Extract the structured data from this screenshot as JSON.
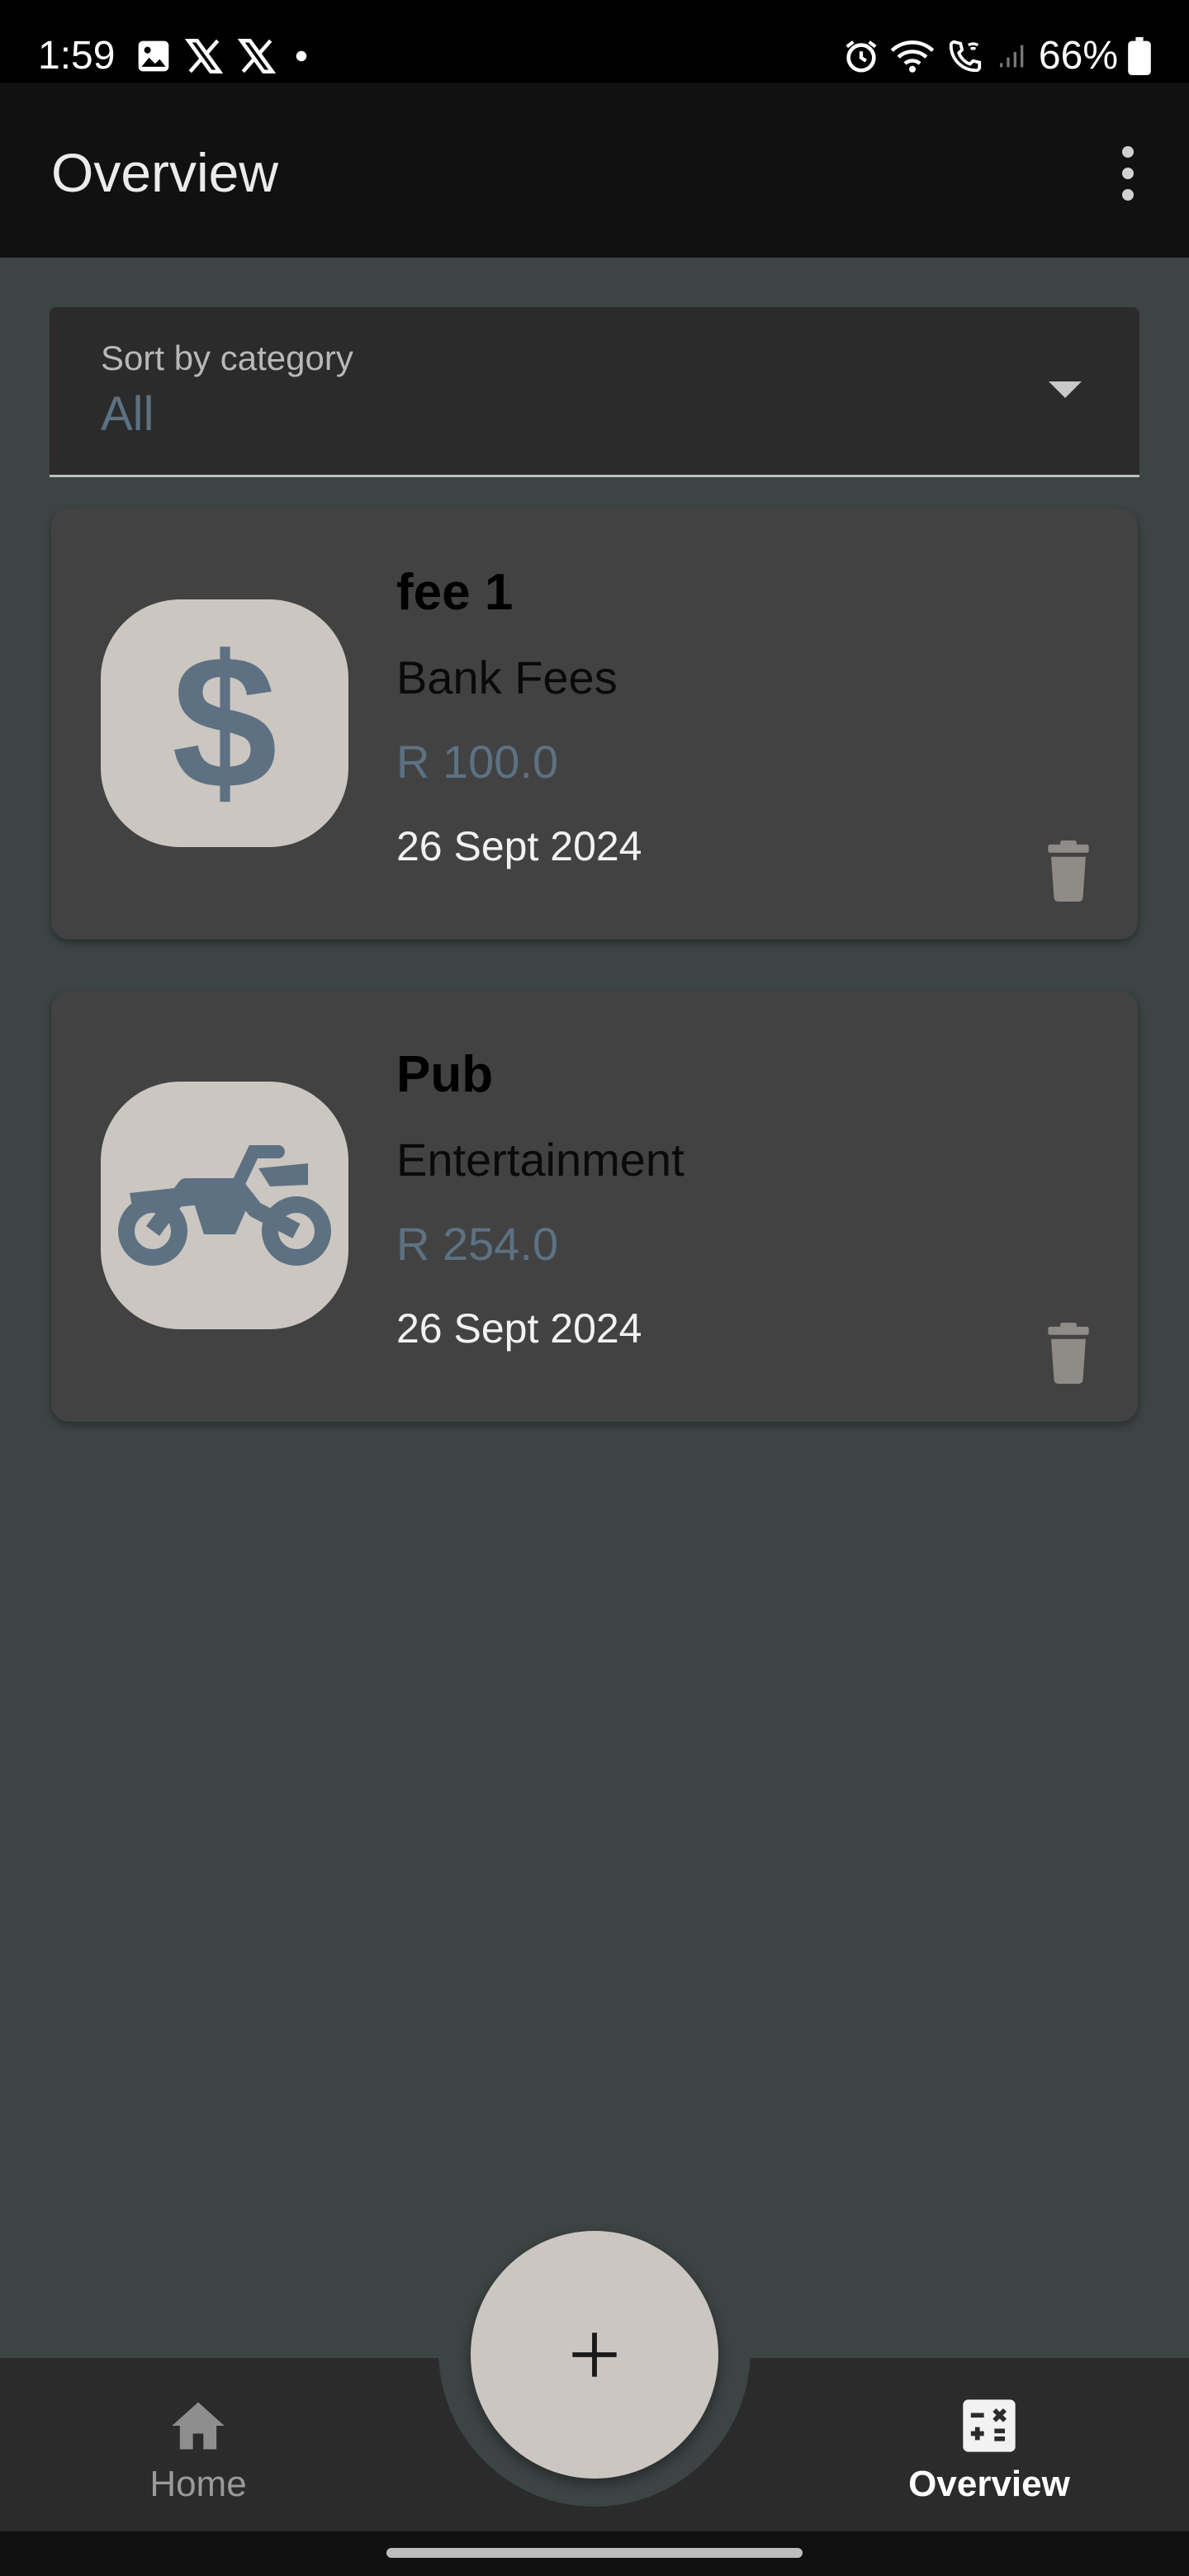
{
  "status_bar": {
    "time": "1:59",
    "battery_percent": "66%",
    "icons_left": [
      "image-icon",
      "x-icon",
      "x-icon",
      "dot-icon"
    ],
    "icons_right": [
      "alarm-icon",
      "wifi-icon",
      "wifi-call-icon",
      "signal-icon",
      "battery-icon"
    ]
  },
  "app_bar": {
    "title": "Overview",
    "menu_icon": "more-vert-icon"
  },
  "sort": {
    "label": "Sort by category",
    "value": "All"
  },
  "expenses": [
    {
      "title": "fee 1",
      "category": "Bank Fees",
      "amount": "R 100.0",
      "date": "26 Sept 2024",
      "icon": "dollar-icon"
    },
    {
      "title": "Pub",
      "category": "Entertainment",
      "amount": "R 254.0",
      "date": "26 Sept 2024",
      "icon": "motorcycle-icon"
    }
  ],
  "bottom_nav": {
    "items": [
      {
        "label": "Home",
        "icon": "home-icon",
        "active": false
      },
      {
        "label": "Overview",
        "icon": "calculator-icon",
        "active": true
      }
    ],
    "fab_icon": "plus-icon"
  },
  "colors": {
    "background": "#3d4444",
    "card": "#424242",
    "icon_tile": "#cbc6c0",
    "accent_blue": "#5d7183"
  }
}
